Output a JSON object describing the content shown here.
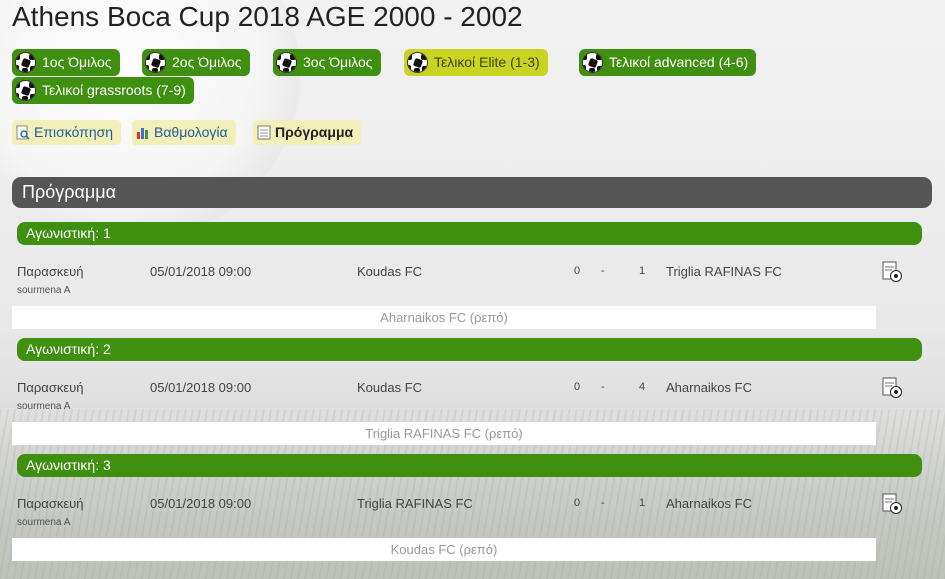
{
  "page": {
    "title": "Athens Boca Cup 2018 AGE 2000 - 2002",
    "section_heading": "Πρόγραμμα"
  },
  "groups": [
    {
      "label": "1ος Όμιλος",
      "active": false
    },
    {
      "label": "2ος Όμιλος",
      "active": false
    },
    {
      "label": "3ος Όμιλος",
      "active": false
    },
    {
      "label": "Τελικοί Elite (1-3)",
      "active": true
    },
    {
      "label": "Τελικοί advanced (4-6)",
      "active": false
    },
    {
      "label": "Τελικοί grassroots (7-9)",
      "active": false
    }
  ],
  "tabs": [
    {
      "label": "Επισκόπηση",
      "icon": "magnifier-document-icon",
      "active": false
    },
    {
      "label": "Βαθμολογία",
      "icon": "bar-chart-icon",
      "active": false
    },
    {
      "label": "Πρόγραμμα",
      "icon": "calendar-icon",
      "active": true
    }
  ],
  "rounds": [
    {
      "label": "Αγωνιστική: 1",
      "match": {
        "day": "Παρασκευή",
        "venue": "sourmena A",
        "datetime": "05/01/2018 09:00",
        "home": "Koudas FC",
        "home_score": "0",
        "separator": "-",
        "away_score": "1",
        "away": "Triglia RAFINAS FC"
      },
      "rest": "Aharnaikos FC (ρεπό)"
    },
    {
      "label": "Αγωνιστική: 2",
      "match": {
        "day": "Παρασκευή",
        "venue": "sourmena A",
        "datetime": "05/01/2018 09:00",
        "home": "Koudas FC",
        "home_score": "0",
        "separator": "-",
        "away_score": "4",
        "away": "Aharnaikos FC"
      },
      "rest": "Triglia RAFINAS FC (ρεπό)"
    },
    {
      "label": "Αγωνιστική: 3",
      "match": {
        "day": "Παρασκευή",
        "venue": "sourmena A",
        "datetime": "05/01/2018 09:00",
        "home": "Triglia RAFINAS FC",
        "home_score": "0",
        "separator": "-",
        "away_score": "1",
        "away": "Aharnaikos FC"
      },
      "rest": "Koudas FC (ρεπό)"
    }
  ],
  "colors": {
    "group_button": "#3f8f11",
    "group_button_active": "#c8d322",
    "tab_background": "#f3efb8",
    "section_bar": "#555555",
    "round_bar": "#3f8f11"
  }
}
